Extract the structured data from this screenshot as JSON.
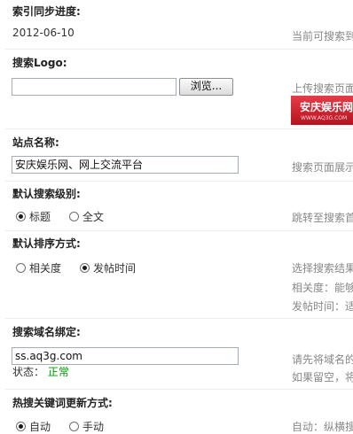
{
  "index_sync": {
    "label": "索引同步进度:",
    "date": "2012-06-10",
    "hint": "当前可搜索到"
  },
  "search_logo": {
    "label": "搜索Logo:",
    "file_value": "",
    "browse_label": "浏览...",
    "hint": "上传搜索页面",
    "banner_text": "安庆娱乐网",
    "banner_sub": "WWW.AQ3G.COM"
  },
  "site_name": {
    "label": "站点名称:",
    "value": "安庆娱乐网、网上交流平台",
    "hint": "搜索页面展示"
  },
  "default_level": {
    "label": "默认搜索级别:",
    "options": [
      "标题",
      "全文"
    ],
    "selected": "标题",
    "hint": "跳转至搜索首"
  },
  "default_sort": {
    "label": "默认排序方式:",
    "options": [
      "相关度",
      "发帖时间"
    ],
    "selected": "发帖时间",
    "hints": [
      "选择搜索结果",
      "相关度：能够",
      "发帖时间：适"
    ]
  },
  "domain_bind": {
    "label": "搜索域名绑定:",
    "value": "ss.aq3g.com",
    "status_label": "状态：",
    "status_value": "正常",
    "hints": [
      "请先将域名的",
      "如果留空，将"
    ]
  },
  "hot_keywords": {
    "label": "热搜关键词更新方式:",
    "options": [
      "自动",
      "手动"
    ],
    "selected": "自动",
    "hint": "自动：纵横搜"
  },
  "colors": {
    "label": "#222222",
    "hint": "#888888",
    "status_ok": "#009900",
    "banner": "#cf2331"
  }
}
